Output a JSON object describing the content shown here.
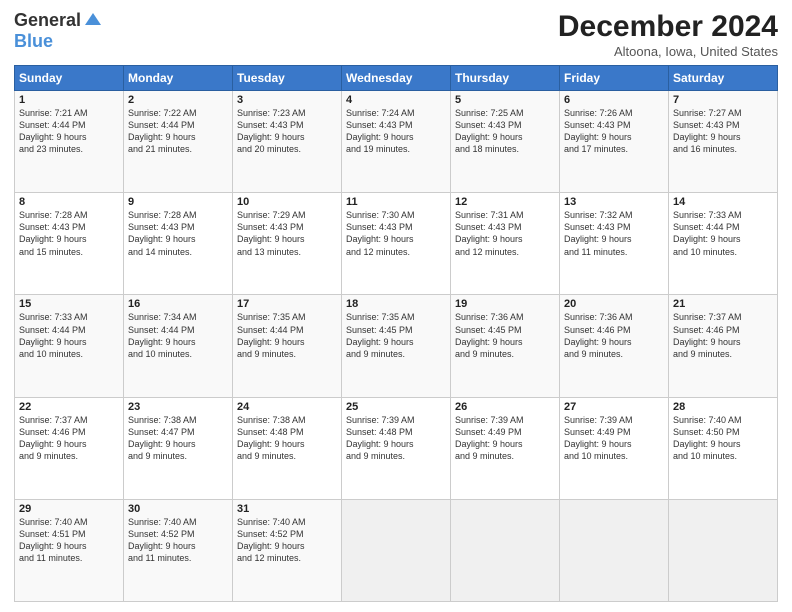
{
  "header": {
    "logo_general": "General",
    "logo_blue": "Blue",
    "title": "December 2024",
    "location": "Altoona, Iowa, United States"
  },
  "days_of_week": [
    "Sunday",
    "Monday",
    "Tuesday",
    "Wednesday",
    "Thursday",
    "Friday",
    "Saturday"
  ],
  "weeks": [
    [
      {
        "day": "1",
        "info": "Sunrise: 7:21 AM\nSunset: 4:44 PM\nDaylight: 9 hours\nand 23 minutes."
      },
      {
        "day": "2",
        "info": "Sunrise: 7:22 AM\nSunset: 4:44 PM\nDaylight: 9 hours\nand 21 minutes."
      },
      {
        "day": "3",
        "info": "Sunrise: 7:23 AM\nSunset: 4:43 PM\nDaylight: 9 hours\nand 20 minutes."
      },
      {
        "day": "4",
        "info": "Sunrise: 7:24 AM\nSunset: 4:43 PM\nDaylight: 9 hours\nand 19 minutes."
      },
      {
        "day": "5",
        "info": "Sunrise: 7:25 AM\nSunset: 4:43 PM\nDaylight: 9 hours\nand 18 minutes."
      },
      {
        "day": "6",
        "info": "Sunrise: 7:26 AM\nSunset: 4:43 PM\nDaylight: 9 hours\nand 17 minutes."
      },
      {
        "day": "7",
        "info": "Sunrise: 7:27 AM\nSunset: 4:43 PM\nDaylight: 9 hours\nand 16 minutes."
      }
    ],
    [
      {
        "day": "8",
        "info": "Sunrise: 7:28 AM\nSunset: 4:43 PM\nDaylight: 9 hours\nand 15 minutes."
      },
      {
        "day": "9",
        "info": "Sunrise: 7:28 AM\nSunset: 4:43 PM\nDaylight: 9 hours\nand 14 minutes."
      },
      {
        "day": "10",
        "info": "Sunrise: 7:29 AM\nSunset: 4:43 PM\nDaylight: 9 hours\nand 13 minutes."
      },
      {
        "day": "11",
        "info": "Sunrise: 7:30 AM\nSunset: 4:43 PM\nDaylight: 9 hours\nand 12 minutes."
      },
      {
        "day": "12",
        "info": "Sunrise: 7:31 AM\nSunset: 4:43 PM\nDaylight: 9 hours\nand 12 minutes."
      },
      {
        "day": "13",
        "info": "Sunrise: 7:32 AM\nSunset: 4:43 PM\nDaylight: 9 hours\nand 11 minutes."
      },
      {
        "day": "14",
        "info": "Sunrise: 7:33 AM\nSunset: 4:44 PM\nDaylight: 9 hours\nand 10 minutes."
      }
    ],
    [
      {
        "day": "15",
        "info": "Sunrise: 7:33 AM\nSunset: 4:44 PM\nDaylight: 9 hours\nand 10 minutes."
      },
      {
        "day": "16",
        "info": "Sunrise: 7:34 AM\nSunset: 4:44 PM\nDaylight: 9 hours\nand 10 minutes."
      },
      {
        "day": "17",
        "info": "Sunrise: 7:35 AM\nSunset: 4:44 PM\nDaylight: 9 hours\nand 9 minutes."
      },
      {
        "day": "18",
        "info": "Sunrise: 7:35 AM\nSunset: 4:45 PM\nDaylight: 9 hours\nand 9 minutes."
      },
      {
        "day": "19",
        "info": "Sunrise: 7:36 AM\nSunset: 4:45 PM\nDaylight: 9 hours\nand 9 minutes."
      },
      {
        "day": "20",
        "info": "Sunrise: 7:36 AM\nSunset: 4:46 PM\nDaylight: 9 hours\nand 9 minutes."
      },
      {
        "day": "21",
        "info": "Sunrise: 7:37 AM\nSunset: 4:46 PM\nDaylight: 9 hours\nand 9 minutes."
      }
    ],
    [
      {
        "day": "22",
        "info": "Sunrise: 7:37 AM\nSunset: 4:46 PM\nDaylight: 9 hours\nand 9 minutes."
      },
      {
        "day": "23",
        "info": "Sunrise: 7:38 AM\nSunset: 4:47 PM\nDaylight: 9 hours\nand 9 minutes."
      },
      {
        "day": "24",
        "info": "Sunrise: 7:38 AM\nSunset: 4:48 PM\nDaylight: 9 hours\nand 9 minutes."
      },
      {
        "day": "25",
        "info": "Sunrise: 7:39 AM\nSunset: 4:48 PM\nDaylight: 9 hours\nand 9 minutes."
      },
      {
        "day": "26",
        "info": "Sunrise: 7:39 AM\nSunset: 4:49 PM\nDaylight: 9 hours\nand 9 minutes."
      },
      {
        "day": "27",
        "info": "Sunrise: 7:39 AM\nSunset: 4:49 PM\nDaylight: 9 hours\nand 10 minutes."
      },
      {
        "day": "28",
        "info": "Sunrise: 7:40 AM\nSunset: 4:50 PM\nDaylight: 9 hours\nand 10 minutes."
      }
    ],
    [
      {
        "day": "29",
        "info": "Sunrise: 7:40 AM\nSunset: 4:51 PM\nDaylight: 9 hours\nand 11 minutes."
      },
      {
        "day": "30",
        "info": "Sunrise: 7:40 AM\nSunset: 4:52 PM\nDaylight: 9 hours\nand 11 minutes."
      },
      {
        "day": "31",
        "info": "Sunrise: 7:40 AM\nSunset: 4:52 PM\nDaylight: 9 hours\nand 12 minutes."
      },
      null,
      null,
      null,
      null
    ]
  ]
}
